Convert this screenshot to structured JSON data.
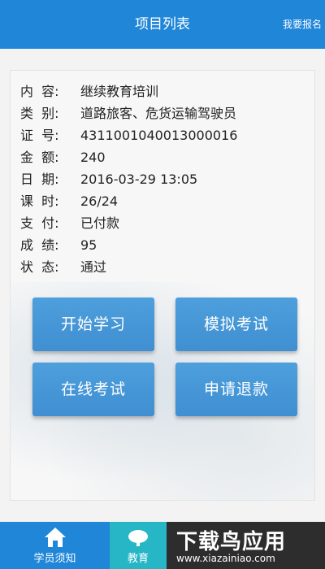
{
  "header": {
    "title": "项目列表",
    "register_label": "我要报名"
  },
  "details": [
    {
      "label": "内  容:",
      "value": "继续教育培训"
    },
    {
      "label": "类  别:",
      "value": "道路旅客、危货运输驾驶员"
    },
    {
      "label": "证  号:",
      "value": "4311001040013000016"
    },
    {
      "label": "金  额:",
      "value": "240"
    },
    {
      "label": "日  期:",
      "value": "2016-03-29 13:05"
    },
    {
      "label": "课  时:",
      "value": "26/24"
    },
    {
      "label": "支  付:",
      "value": "已付款"
    },
    {
      "label": "成  绩:",
      "value": "95"
    },
    {
      "label": "状  态:",
      "value": "通过"
    }
  ],
  "buttons": {
    "start_study": "开始学习",
    "mock_exam": "模拟考试",
    "online_exam": "在线考试",
    "refund": "申请退款"
  },
  "bottom_nav": {
    "item1_label": "学员须知",
    "item1_icon": "home-icon",
    "item2_label": "教育",
    "item2_icon": "education-icon"
  },
  "watermark": {
    "text": "下载鸟应用",
    "url": "www.xiazainiao.com"
  },
  "colors": {
    "primary": "#1f86d8",
    "button": "#4596d6",
    "active_tab": "#27b6c6"
  }
}
